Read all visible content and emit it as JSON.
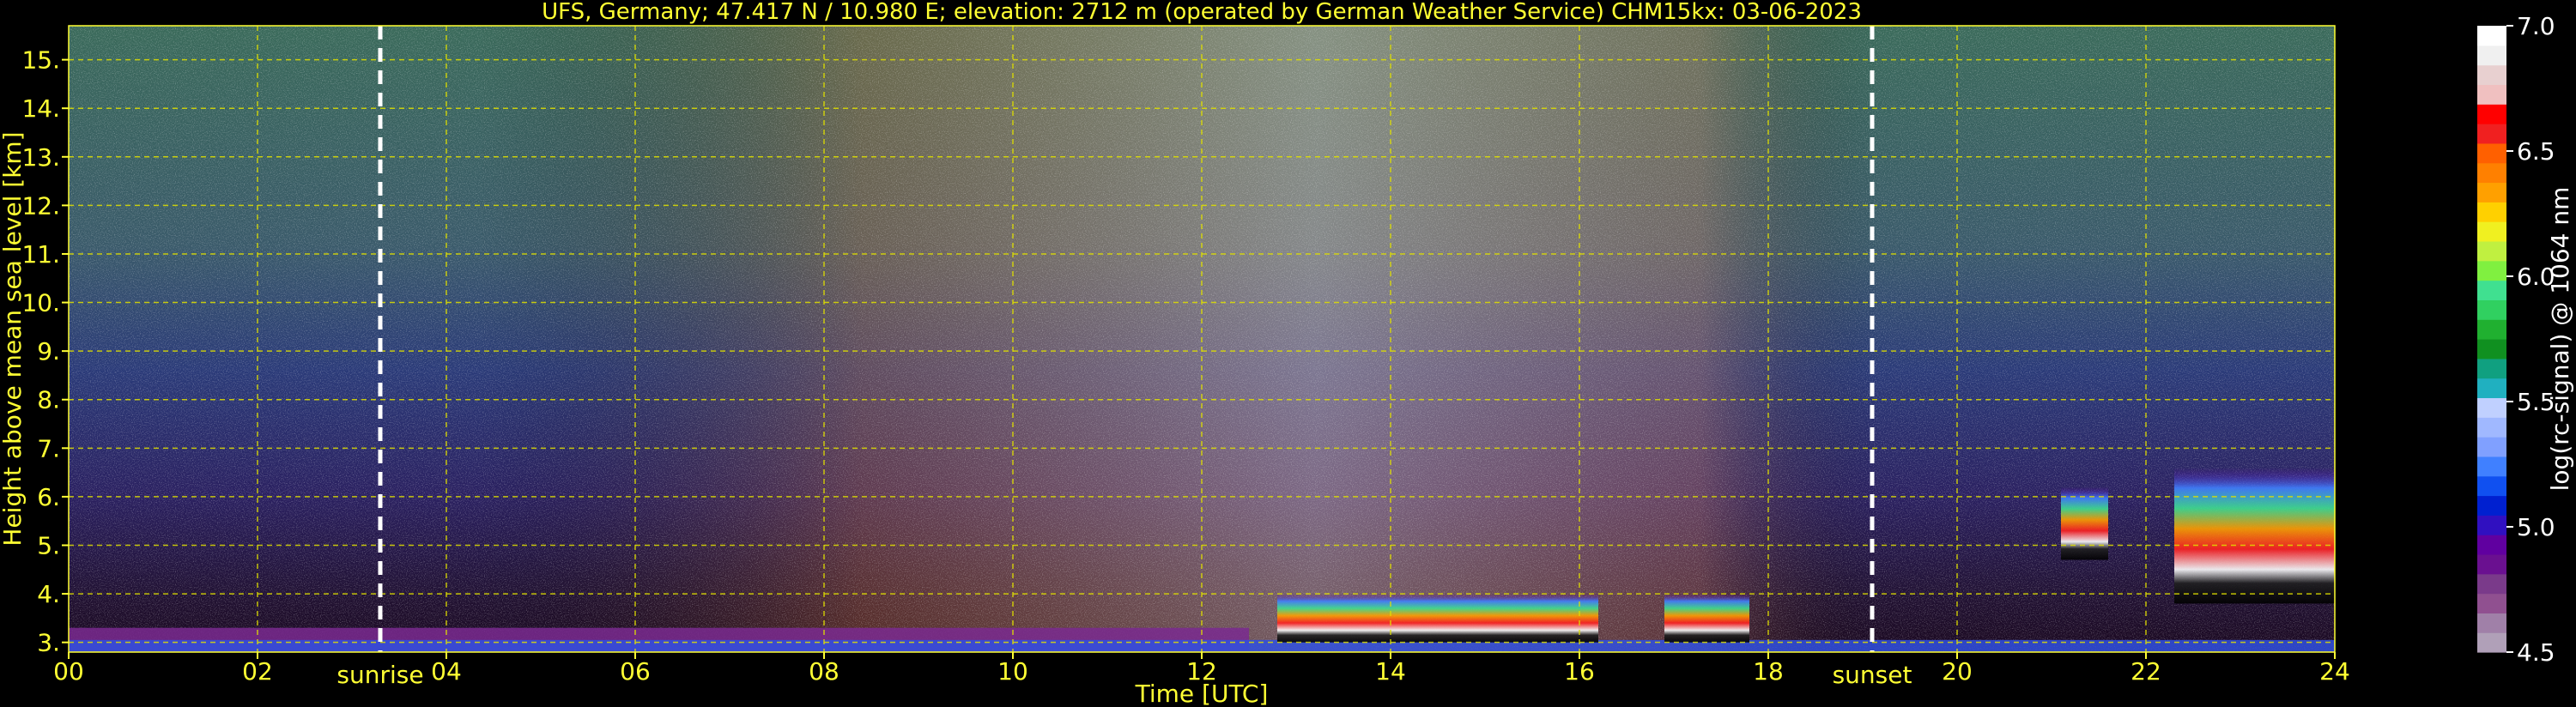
{
  "chart_data": [
    {
      "type": "heatmap",
      "title": "UFS, Germany; 47.417 N / 10.980 E; elevation: 2712 m  (operated by German Weather Service)    CHM15kx: 03-06-2023",
      "xlabel": "Time [UTC]",
      "ylabel": "Height above mean sea level [km]",
      "xlim": [
        0,
        24
      ],
      "ylim": [
        2.8,
        15.7
      ],
      "x_ticks": [
        0,
        2,
        4,
        6,
        8,
        10,
        12,
        14,
        16,
        18,
        20,
        22,
        24
      ],
      "x_tick_labels": [
        "00",
        "02",
        "04",
        "06",
        "08",
        "10",
        "12",
        "14",
        "16",
        "18",
        "20",
        "22",
        "24"
      ],
      "y_ticks": [
        3,
        4,
        5,
        6,
        7,
        8,
        9,
        10,
        11,
        12,
        13,
        14,
        15
      ],
      "y_tick_labels": [
        "3.",
        "4.",
        "5.",
        "6.",
        "7.",
        "8.",
        "9.",
        "10.",
        "11.",
        "12.",
        "13.",
        "14.",
        "15."
      ],
      "grid": true,
      "grid_color": "#e0e000",
      "annotations": [
        {
          "label": "sunrise",
          "x": 3.3
        },
        {
          "label": "sunset",
          "x": 19.1
        }
      ],
      "features": {
        "boundary_layer_top_km": 3.3,
        "cloud_layers": [
          {
            "x_range": [
              12.8,
              16.2
            ],
            "height_km": [
              3.0,
              4.0
            ]
          },
          {
            "x_range": [
              16.9,
              17.8
            ],
            "height_km": [
              3.0,
              4.0
            ]
          },
          {
            "x_range": [
              21.1,
              21.6
            ],
            "height_km": [
              4.7,
              6.2
            ]
          },
          {
            "x_range": [
              22.3,
              24.0
            ],
            "height_km": [
              3.8,
              6.6
            ]
          }
        ]
      }
    },
    {
      "type": "heatmap",
      "role": "colorbar",
      "label": "log(rc-signal) @ 1064 nm",
      "range": [
        4.5,
        7.0
      ],
      "ticks": [
        4.5,
        5.0,
        5.5,
        6.0,
        6.5,
        7.0
      ],
      "tick_labels": [
        "4.5",
        "5.0",
        "5.5",
        "6.0",
        "6.5",
        "7.0"
      ],
      "colors": [
        "#b0a0b8",
        "#a080a8",
        "#905090",
        "#7a3a8a",
        "#6a1090",
        "#6000a0",
        "#3010c0",
        "#0020d0",
        "#1050f0",
        "#4080ff",
        "#80a0ff",
        "#a0b8ff",
        "#c0d0ff",
        "#20b0c0",
        "#10a080",
        "#109020",
        "#20b030",
        "#30d060",
        "#40e090",
        "#80f040",
        "#c0f040",
        "#f0f020",
        "#ffd000",
        "#ffa000",
        "#ff8000",
        "#ff6000",
        "#f02020",
        "#ff0000",
        "#f0c0c0",
        "#e8d0d0",
        "#f0f0f0",
        "#ffffff"
      ]
    }
  ]
}
